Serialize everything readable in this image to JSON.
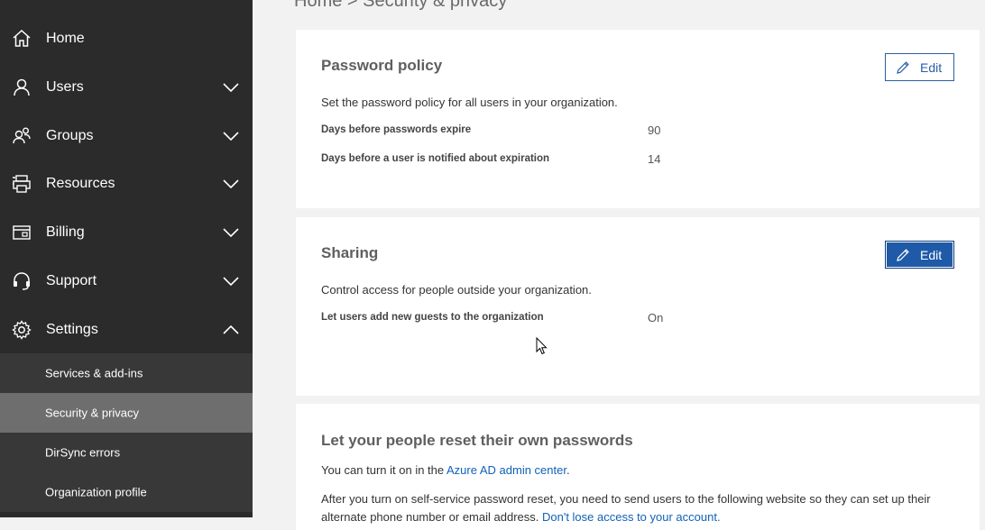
{
  "sidebar": {
    "items": [
      {
        "label": "Home",
        "icon": "home-icon",
        "expandable": false
      },
      {
        "label": "Users",
        "icon": "user-icon",
        "expandable": true,
        "expanded": false
      },
      {
        "label": "Groups",
        "icon": "groups-icon",
        "expandable": true,
        "expanded": false
      },
      {
        "label": "Resources",
        "icon": "resources-icon",
        "expandable": true,
        "expanded": false
      },
      {
        "label": "Billing",
        "icon": "billing-icon",
        "expandable": true,
        "expanded": false
      },
      {
        "label": "Support",
        "icon": "headset-icon",
        "expandable": true,
        "expanded": false
      },
      {
        "label": "Settings",
        "icon": "gear-icon",
        "expandable": true,
        "expanded": true
      }
    ],
    "settings_subitems": [
      {
        "label": "Services & add-ins",
        "selected": false
      },
      {
        "label": "Security & privacy",
        "selected": true
      },
      {
        "label": "DirSync errors",
        "selected": false
      },
      {
        "label": "Organization profile",
        "selected": false
      }
    ]
  },
  "breadcrumb": "Home > Security & privacy",
  "password_policy": {
    "title": "Password policy",
    "description": "Set the password policy for all users in your organization.",
    "edit_label": "Edit",
    "props": [
      {
        "label": "Days before passwords expire",
        "value": "90"
      },
      {
        "label": "Days before a user is notified about expiration",
        "value": "14"
      }
    ]
  },
  "sharing": {
    "title": "Sharing",
    "description": "Control access for people outside your organization.",
    "edit_label": "Edit",
    "props": [
      {
        "label": "Let users add new guests to the organization",
        "value": "On"
      }
    ]
  },
  "self_reset": {
    "title": "Let your people reset their own passwords",
    "line1_text": "You can turn it on in the ",
    "line1_link": "Azure AD admin center",
    "line1_end": ".",
    "line2_text": "After you turn on self-service password reset, you need to send users to the following website so they can set up their",
    "line3_text": "alternate phone number or email address. ",
    "line3_link": "Don't lose access to your account."
  },
  "colors": {
    "sidebar_bg": "#2b2b2b",
    "submenu_bg": "#383838",
    "selected_bg": "#6e6e6e",
    "accent": "#2a5fa3",
    "link": "#0f62b6"
  }
}
